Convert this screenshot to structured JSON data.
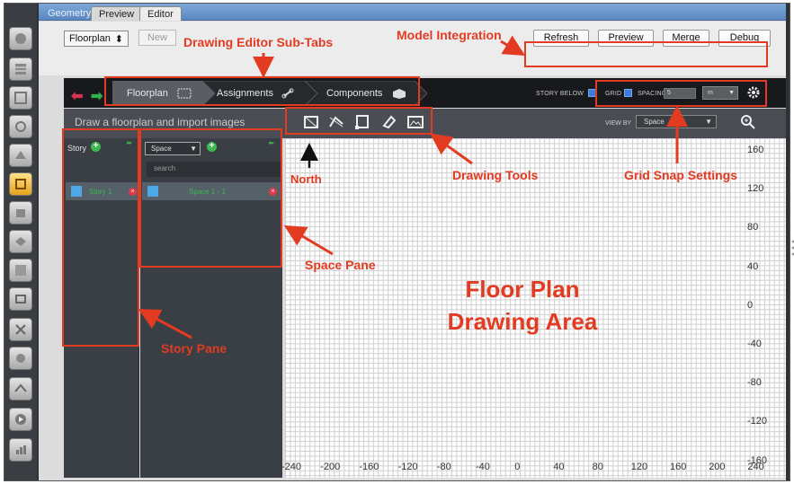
{
  "window": {
    "tabs": [
      {
        "label": "Geometry"
      },
      {
        "label": "Preview"
      },
      {
        "label": "Editor"
      }
    ]
  },
  "topbar": {
    "mode_select": "Floorplan",
    "new_label": "New",
    "buttons": [
      "Refresh",
      "Preview",
      "Merge",
      "Debug"
    ]
  },
  "subtabs": [
    {
      "label": "Floorplan"
    },
    {
      "label": "Assignments"
    },
    {
      "label": "Components"
    }
  ],
  "header": {
    "story_below_label": "STORY BELOW",
    "story_below_checked": true,
    "grid_label": "GRID",
    "grid_checked": true,
    "spacing_label": "SPACING",
    "spacing_value": "5",
    "unit_value": "m"
  },
  "toolbar": {
    "hint": "Draw a floorplan and import images",
    "view_by_label": "VIEW BY",
    "view_by_value": "Space"
  },
  "story_pane": {
    "title": "Story",
    "items": [
      {
        "name": "Story 1"
      }
    ]
  },
  "space_pane": {
    "type_select": "Space",
    "search_placeholder": "search",
    "items": [
      {
        "name": "Space 1 - 1"
      }
    ]
  },
  "canvas": {
    "x_ticks": [
      "-240",
      "-200",
      "-160",
      "-120",
      "-80",
      "-40",
      "0",
      "40",
      "80",
      "120",
      "160",
      "200",
      "240"
    ],
    "y_ticks": [
      "160",
      "120",
      "80",
      "40",
      "0",
      "-40",
      "-80",
      "-120",
      "-160"
    ]
  },
  "annotations": {
    "sub_tabs": "Drawing Editor Sub-Tabs",
    "model_integration": "Model Integration",
    "north": "North",
    "drawing_tools": "Drawing Tools",
    "grid_snap": "Grid Snap Settings",
    "space_pane": "Space Pane",
    "story_pane": "Story Pane",
    "floor_plan_line1": "Floor Plan",
    "floor_plan_line2": "Drawing Area"
  },
  "colors": {
    "annotation": "#e23b22",
    "accent_green": "#3cb94f",
    "accent_red": "#e03a4a",
    "accent_blue": "#4ea8e8"
  }
}
